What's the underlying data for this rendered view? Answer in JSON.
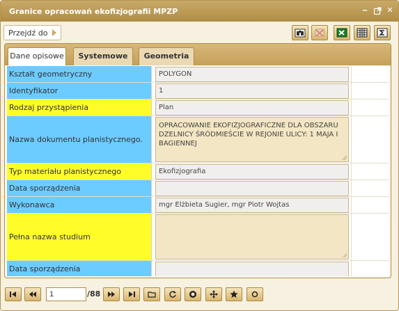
{
  "window": {
    "title": "Granice opracowań ekofizjografii MPZP",
    "controls": [
      "minimize-icon",
      "popout-icon",
      "close-icon"
    ]
  },
  "toolbar": {
    "goto_label": "Przejdź do",
    "buttons": [
      "binoculars-icon",
      "map-disabled-icon",
      "excel-icon",
      "table-icon",
      "sum-icon"
    ]
  },
  "tabs": [
    {
      "label": "Dane opisowe",
      "active": true
    },
    {
      "label": "Systemowe",
      "active": false
    },
    {
      "label": "Geometria",
      "active": false
    }
  ],
  "rows": [
    {
      "label": "Kształt geometryczny",
      "color": "blue",
      "value": "POLYGON"
    },
    {
      "label": "Identyfikator",
      "color": "blue",
      "value": "1"
    },
    {
      "label": "Rodzaj przystąpienia",
      "color": "yellow",
      "value": "Plan"
    },
    {
      "label": "Nazwa dokumentu planistycznego.",
      "color": "blue",
      "value": "OPRACOWANIE EKOFIZJOGRAFICZNE DLA OBSZARU DZELNICY ŚRÓDMIEŚCIE W REJONIE ULICY: 1 MAJA I BAGIENNEJ"
    },
    {
      "label": "Typ materiału planistycznego",
      "color": "yellow",
      "value": "Ekofizjografia"
    },
    {
      "label": "Data sporządzenia",
      "color": "blue",
      "value": ""
    },
    {
      "label": "Wykonawca",
      "color": "blue",
      "value": "mgr Elżbieta Sugier, mgr Piotr Wojtas"
    },
    {
      "label": "Pełna nazwa studium",
      "color": "yellow",
      "value": ""
    },
    {
      "label": "Data sporządzenia",
      "color": "blue",
      "value": ""
    }
  ],
  "pager": {
    "current_page": "1",
    "total": "/88",
    "buttons": [
      "first-page-icon",
      "prev-page-icon",
      "next-page-icon",
      "last-page-icon",
      "folder-icon",
      "refresh-icon",
      "zoom-icon",
      "pan-icon",
      "star-icon",
      "circle-icon"
    ]
  },
  "colors": {
    "accent": "#c4a05a",
    "label_blue": "#6ccbff",
    "label_yellow": "#fffc2a"
  }
}
